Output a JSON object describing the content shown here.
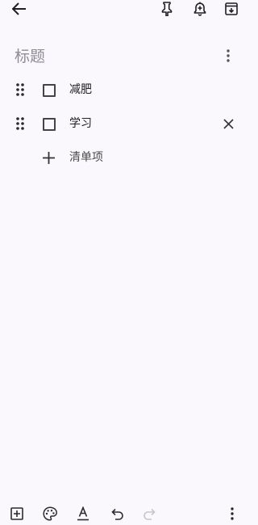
{
  "note": {
    "title_placeholder": "标题",
    "items": [
      {
        "label": "减肥",
        "checked": false
      },
      {
        "label": "学习",
        "checked": false
      }
    ],
    "add_item_label": "清单项"
  },
  "icons": {
    "back": "arrow-left-icon",
    "pin": "pin-icon",
    "reminder": "bell-plus-icon",
    "archive": "archive-icon",
    "more": "more-vertical-icon",
    "drag": "drag-handle-icon",
    "remove": "close-icon",
    "add": "plus-icon",
    "add_box": "add-box-icon",
    "palette": "palette-icon",
    "text_format": "text-format-icon",
    "undo": "undo-icon",
    "redo": "redo-icon"
  },
  "colors": {
    "background": "#fbf8fd",
    "icon": "#1f1f1f",
    "placeholder": "#8f8c93",
    "disabled": "#c7c5cc"
  }
}
